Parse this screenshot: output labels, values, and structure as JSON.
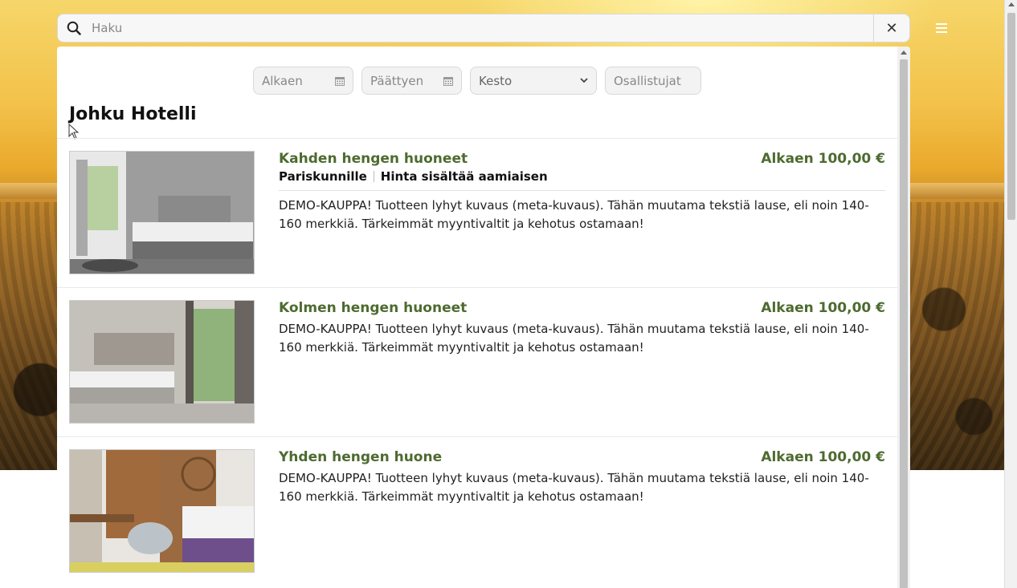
{
  "search": {
    "placeholder": "Haku",
    "clear_label": "✕"
  },
  "filters": {
    "start_placeholder": "Alkaen",
    "end_placeholder": "Päättyen",
    "duration_selected": "Kesto",
    "participants_placeholder": "Osallistujat"
  },
  "hotel": {
    "title": "Johku Hotelli"
  },
  "rooms": [
    {
      "name": "Kahden hengen huoneet",
      "price": "Alkaen 100,00 €",
      "tags": [
        "Pariskunnille",
        "Hinta sisältää aamiaisen"
      ],
      "description": "DEMO-KAUPPA! Tuotteen lyhyt kuvaus (meta-kuvaus). Tähän muutama tekstiä lause, eli noin 140-160 merkkiä. Tärkeimmät myyntivaltit ja kehotus ostamaan!"
    },
    {
      "name": "Kolmen hengen huoneet",
      "price": "Alkaen 100,00 €",
      "description": "DEMO-KAUPPA! Tuotteen lyhyt kuvaus (meta-kuvaus). Tähän muutama tekstiä lause, eli noin 140-160 merkkiä. Tärkeimmät myyntivaltit ja kehotus ostamaan!"
    },
    {
      "name": "Yhden hengen huone",
      "price": "Alkaen 100,00 €",
      "description": "DEMO-KAUPPA! Tuotteen lyhyt kuvaus (meta-kuvaus). Tähän muutama tekstiä lause, eli noin 140-160 merkkiä. Tärkeimmät myyntivaltit ja kehotus ostamaan!"
    }
  ],
  "colors": {
    "accent": "#4d6b2f",
    "input_bg": "#f3f3f3"
  }
}
